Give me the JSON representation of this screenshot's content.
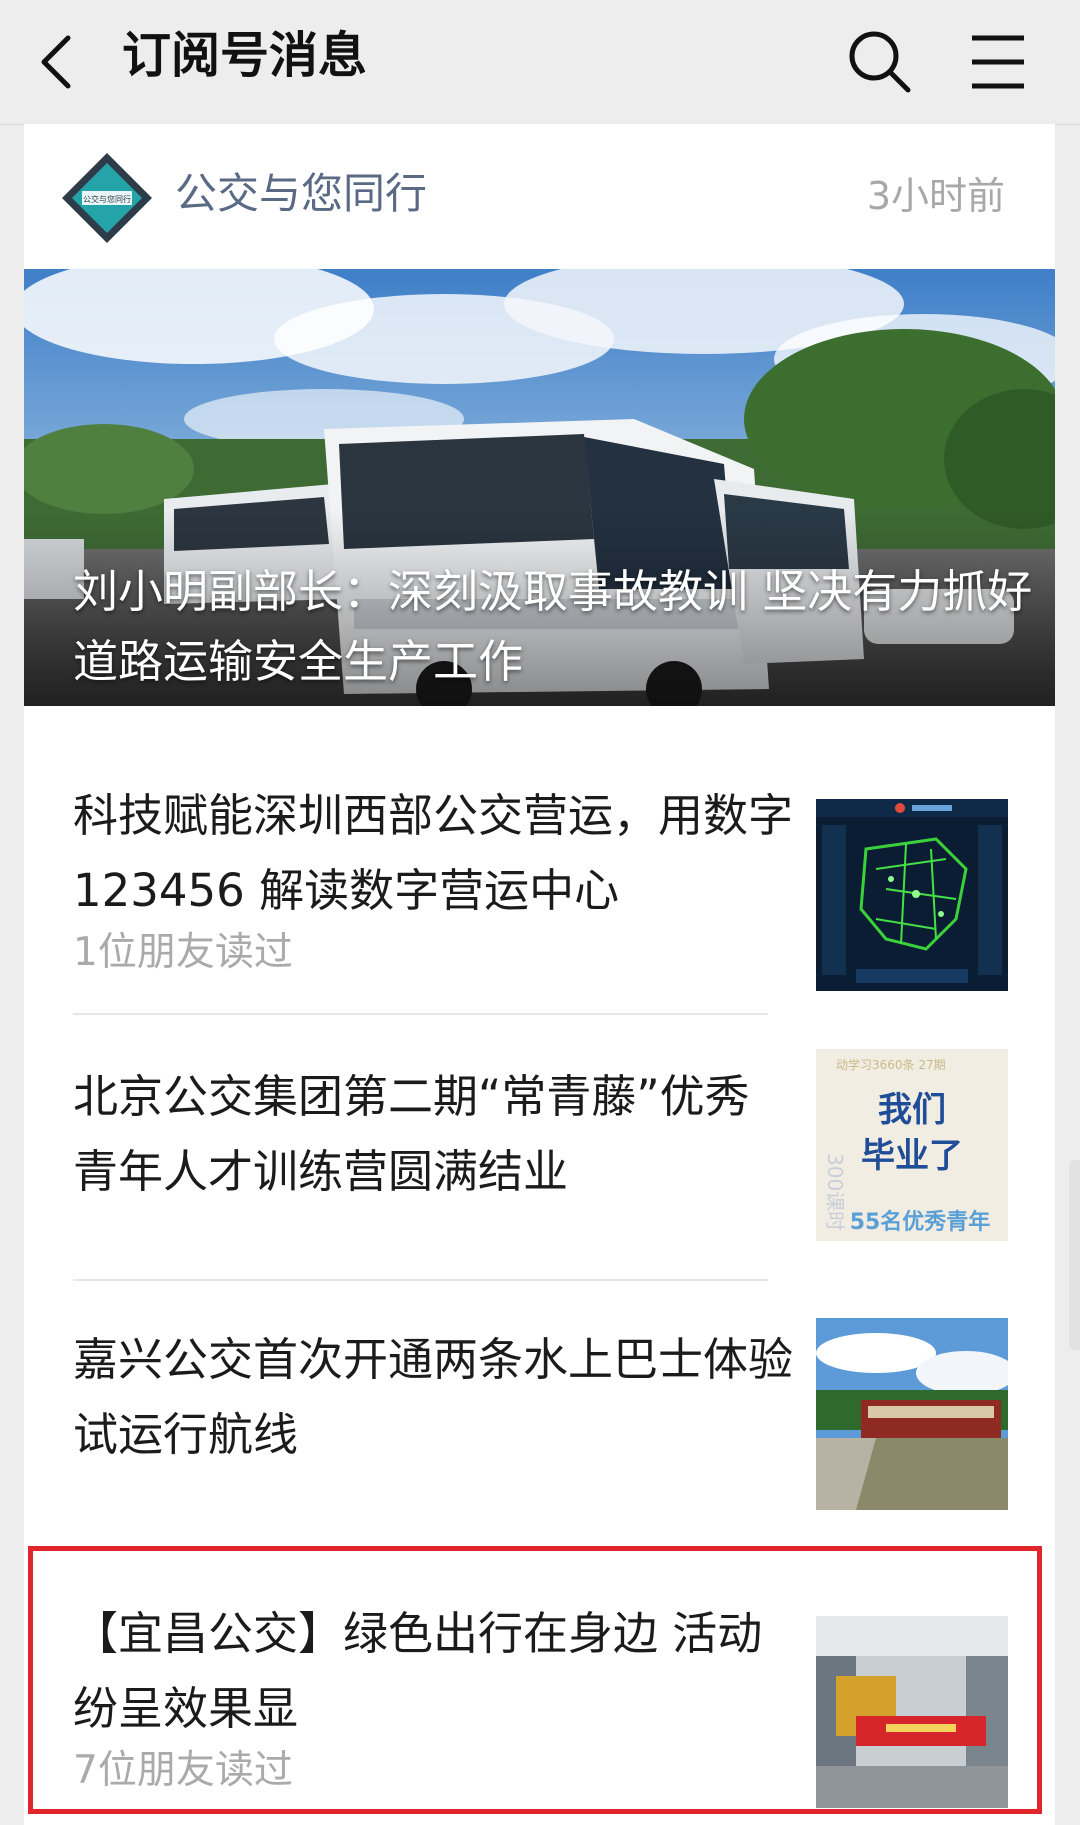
{
  "header": {
    "title": "订阅号消息",
    "back_icon": "chevron-left-icon",
    "search_icon": "search-icon",
    "menu_icon": "menu-icon"
  },
  "account": {
    "name": "公交与您同行",
    "time": "3小时前",
    "logo_text": "公交与您同行"
  },
  "hero": {
    "title": "刘小明副部长：深刻汲取事故教训 坚决有力抓好道路运输安全生产工作"
  },
  "articles": [
    {
      "title": "科技赋能深圳西部公交营运，用数字 123456 解读数字营运中心",
      "meta": "1位朋友读过",
      "thumb": "map-dashboard"
    },
    {
      "title": "北京公交集团第二期“常青藤”优秀青年人才训练营圆满结业",
      "meta": "",
      "thumb": "graduation-poster",
      "thumb_texts": {
        "line1": "我们",
        "line2": "毕业了",
        "line3": "55名优秀青年"
      }
    },
    {
      "title": "嘉兴公交首次开通两条水上巴士体验试运行航线",
      "meta": "",
      "thumb": "boat-photo"
    },
    {
      "title": "【宜昌公交】绿色出行在身边 活动纷呈效果显",
      "meta": "7位朋友读过",
      "thumb": "bus-station-photo"
    }
  ],
  "colors": {
    "background": "#ededed",
    "card": "#ffffff",
    "account_name": "#5a6a85",
    "highlight_border": "#e0262a"
  }
}
